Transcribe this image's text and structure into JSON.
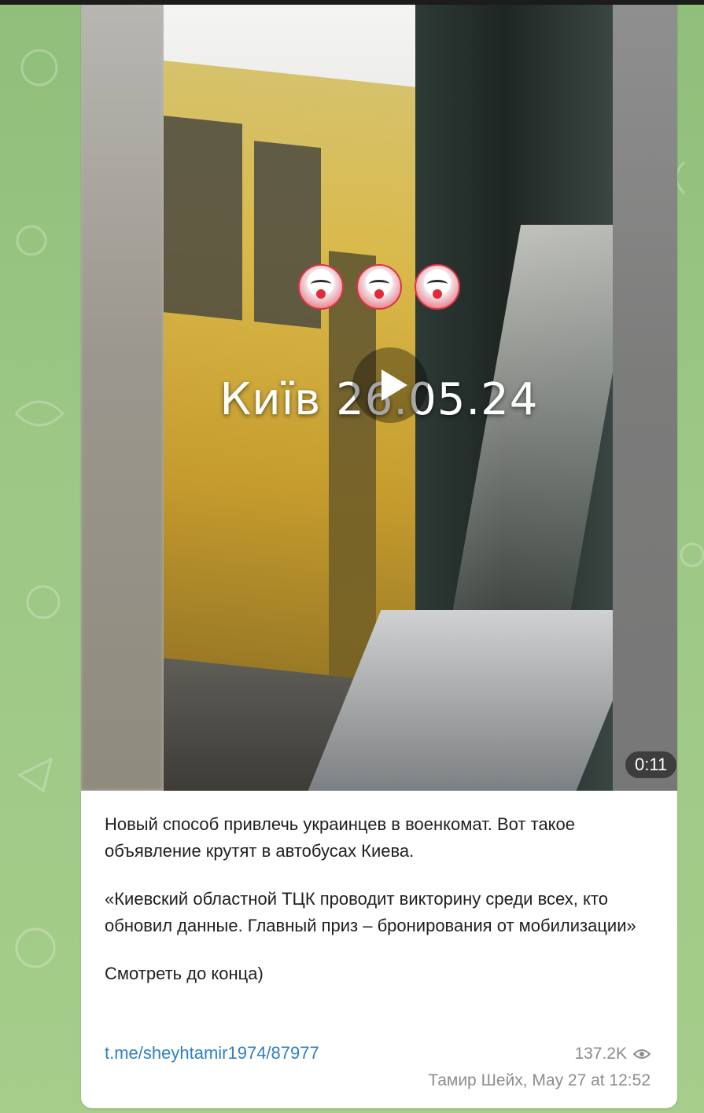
{
  "post": {
    "video": {
      "overlay_text": "Київ 26.05.24",
      "emoji": [
        "clown-face",
        "clown-face",
        "clown-face"
      ],
      "duration": "0:11"
    },
    "caption": {
      "paragraph1": "Новый способ привлечь украинцев в военкомат. Вот такое объявление крутят в автобусах Киева.",
      "paragraph2": "«Киевский областной ТЦК проводит викторину среди всех, кто обновил данные. Главный приз – бронирования от мобилизации»",
      "paragraph3": "Смотреть до конца)"
    },
    "link": "t.me/sheyhtamir1974/87977",
    "views": "137.2K",
    "author_date": "Тамир Шейх, May 27 at 12:52"
  },
  "colors": {
    "chat_background": "#9cc785",
    "link": "#2f7fc4",
    "meta_text": "#8c8c8c",
    "bus_yellow": "#d9b94a"
  }
}
